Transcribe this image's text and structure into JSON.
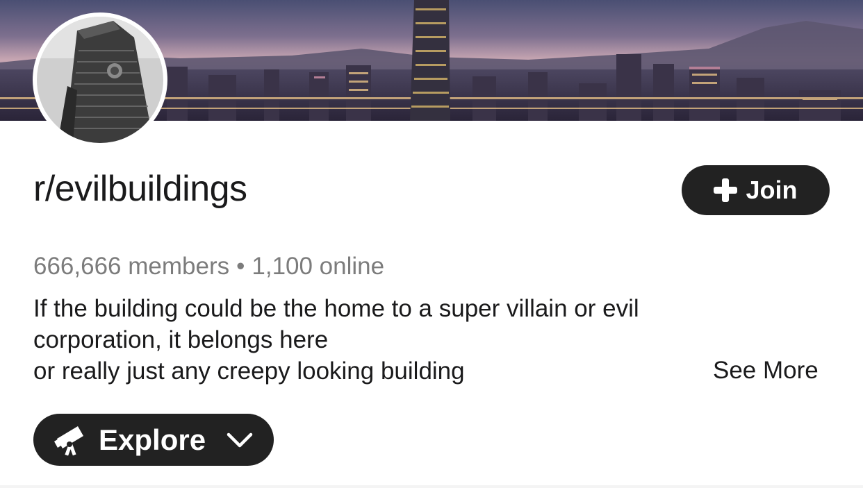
{
  "banner": {
    "icon": "city-skyline-image"
  },
  "avatar": {
    "icon": "skyscraper-image"
  },
  "community": {
    "name": "r/evilbuildings",
    "join_label": "Join",
    "join_icon": "plus-icon",
    "members": "666,666 members",
    "separator": "•",
    "online": "1,100 online",
    "description_lines": [
      "If the building could be the home to a super villain or evil",
      "corporation, it belongs here",
      "or really just any creepy looking building"
    ],
    "see_more_label": "See More"
  },
  "explore": {
    "label": "Explore",
    "icon": "telescope-icon",
    "chevron_icon": "chevron-down-icon"
  },
  "colors": {
    "button_bg": "#222222",
    "muted_text": "#7c7c7c",
    "text": "#1a1a1b"
  }
}
